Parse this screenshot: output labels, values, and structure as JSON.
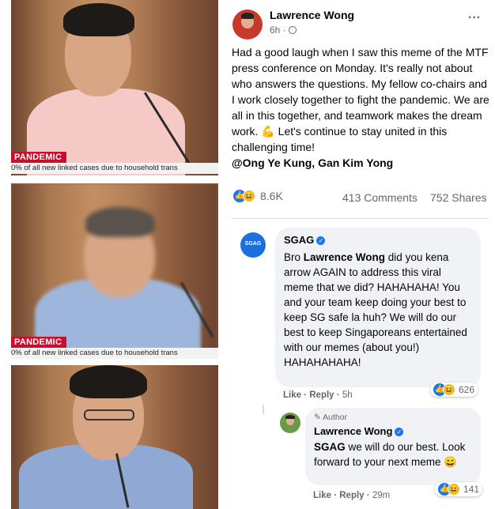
{
  "left_panels": [
    {
      "tag": "PANDEMIC",
      "caption": "0% of all new linked cases due to household trans"
    },
    {
      "tag": "PANDEMIC",
      "caption": "0% of all new linked cases due to household trans"
    }
  ],
  "post": {
    "author": "Lawrence Wong",
    "time": "6h · ",
    "more": "···",
    "body": "Had a good laugh when I saw this meme of the MTF press conference on Monday. It's really not about who answers the questions. My fellow co-chairs and I work closely together to fight the pandemic. We are all in this together, and teamwork makes the dream work. 💪 Let's continue to stay united in this challenging time!",
    "mentions": "@Ong Ye Kung, Gan Kim Yong",
    "reactions_count": "8.6K",
    "comments": "413 Comments",
    "shares": "752 Shares"
  },
  "comment1": {
    "avatar_text": "SGAG",
    "name": "SGAG",
    "text_pre": "Bro ",
    "text_name": "Lawrence Wong",
    "text_post": " did you kena arrow AGAIN to address this viral meme that we did? HAHAHAHA! You and your team keep doing your best to keep SG safe la huh? We will do our best to keep Singaporeans entertained with our memes (about you!) HAHAHAHAHA!",
    "like": "Like",
    "reply": "Reply",
    "time": "5h",
    "reactions": "626"
  },
  "comment2": {
    "author_badge": "Author",
    "name": "Lawrence Wong",
    "text_name": "SGAG",
    "text_post": " we will do our best. Look forward to your next meme 😄",
    "like": "Like",
    "reply": "Reply",
    "time": "29m",
    "reactions": "141"
  },
  "colors": {
    "link": "#1877f2",
    "banner_red": "#c8102e",
    "bubble": "#f0f2f5",
    "muted": "#65676b"
  }
}
